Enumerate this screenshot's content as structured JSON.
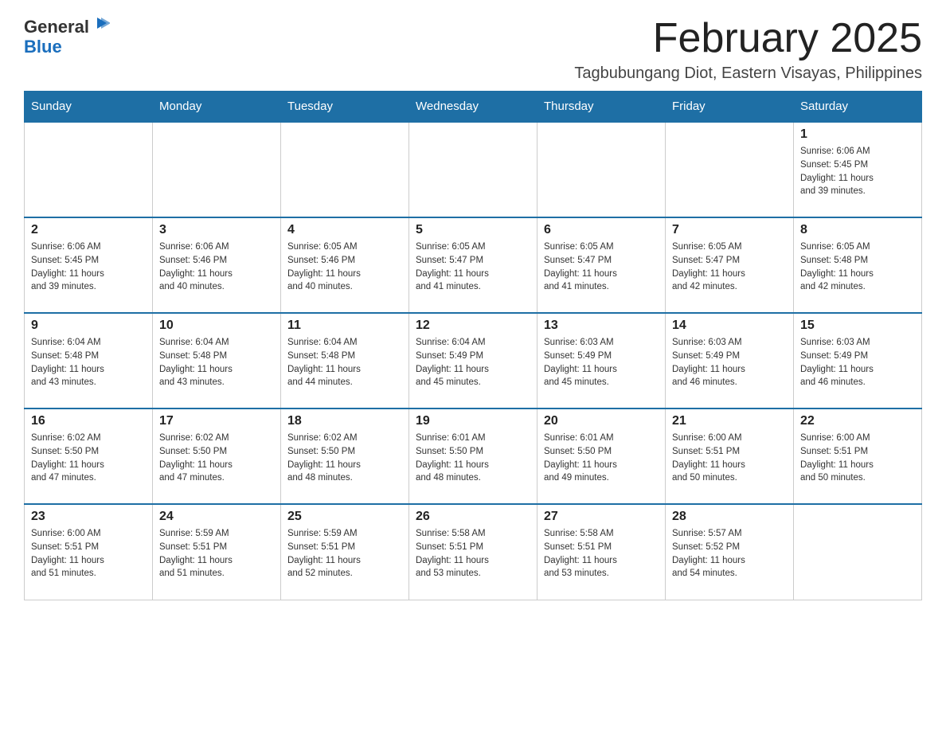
{
  "header": {
    "logo_general": "General",
    "logo_blue": "Blue",
    "title": "February 2025",
    "subtitle": "Tagbubungang Diot, Eastern Visayas, Philippines"
  },
  "days_of_week": [
    "Sunday",
    "Monday",
    "Tuesday",
    "Wednesday",
    "Thursday",
    "Friday",
    "Saturday"
  ],
  "weeks": [
    [
      {
        "day": "",
        "info": ""
      },
      {
        "day": "",
        "info": ""
      },
      {
        "day": "",
        "info": ""
      },
      {
        "day": "",
        "info": ""
      },
      {
        "day": "",
        "info": ""
      },
      {
        "day": "",
        "info": ""
      },
      {
        "day": "1",
        "info": "Sunrise: 6:06 AM\nSunset: 5:45 PM\nDaylight: 11 hours\nand 39 minutes."
      }
    ],
    [
      {
        "day": "2",
        "info": "Sunrise: 6:06 AM\nSunset: 5:45 PM\nDaylight: 11 hours\nand 39 minutes."
      },
      {
        "day": "3",
        "info": "Sunrise: 6:06 AM\nSunset: 5:46 PM\nDaylight: 11 hours\nand 40 minutes."
      },
      {
        "day": "4",
        "info": "Sunrise: 6:05 AM\nSunset: 5:46 PM\nDaylight: 11 hours\nand 40 minutes."
      },
      {
        "day": "5",
        "info": "Sunrise: 6:05 AM\nSunset: 5:47 PM\nDaylight: 11 hours\nand 41 minutes."
      },
      {
        "day": "6",
        "info": "Sunrise: 6:05 AM\nSunset: 5:47 PM\nDaylight: 11 hours\nand 41 minutes."
      },
      {
        "day": "7",
        "info": "Sunrise: 6:05 AM\nSunset: 5:47 PM\nDaylight: 11 hours\nand 42 minutes."
      },
      {
        "day": "8",
        "info": "Sunrise: 6:05 AM\nSunset: 5:48 PM\nDaylight: 11 hours\nand 42 minutes."
      }
    ],
    [
      {
        "day": "9",
        "info": "Sunrise: 6:04 AM\nSunset: 5:48 PM\nDaylight: 11 hours\nand 43 minutes."
      },
      {
        "day": "10",
        "info": "Sunrise: 6:04 AM\nSunset: 5:48 PM\nDaylight: 11 hours\nand 43 minutes."
      },
      {
        "day": "11",
        "info": "Sunrise: 6:04 AM\nSunset: 5:48 PM\nDaylight: 11 hours\nand 44 minutes."
      },
      {
        "day": "12",
        "info": "Sunrise: 6:04 AM\nSunset: 5:49 PM\nDaylight: 11 hours\nand 45 minutes."
      },
      {
        "day": "13",
        "info": "Sunrise: 6:03 AM\nSunset: 5:49 PM\nDaylight: 11 hours\nand 45 minutes."
      },
      {
        "day": "14",
        "info": "Sunrise: 6:03 AM\nSunset: 5:49 PM\nDaylight: 11 hours\nand 46 minutes."
      },
      {
        "day": "15",
        "info": "Sunrise: 6:03 AM\nSunset: 5:49 PM\nDaylight: 11 hours\nand 46 minutes."
      }
    ],
    [
      {
        "day": "16",
        "info": "Sunrise: 6:02 AM\nSunset: 5:50 PM\nDaylight: 11 hours\nand 47 minutes."
      },
      {
        "day": "17",
        "info": "Sunrise: 6:02 AM\nSunset: 5:50 PM\nDaylight: 11 hours\nand 47 minutes."
      },
      {
        "day": "18",
        "info": "Sunrise: 6:02 AM\nSunset: 5:50 PM\nDaylight: 11 hours\nand 48 minutes."
      },
      {
        "day": "19",
        "info": "Sunrise: 6:01 AM\nSunset: 5:50 PM\nDaylight: 11 hours\nand 48 minutes."
      },
      {
        "day": "20",
        "info": "Sunrise: 6:01 AM\nSunset: 5:50 PM\nDaylight: 11 hours\nand 49 minutes."
      },
      {
        "day": "21",
        "info": "Sunrise: 6:00 AM\nSunset: 5:51 PM\nDaylight: 11 hours\nand 50 minutes."
      },
      {
        "day": "22",
        "info": "Sunrise: 6:00 AM\nSunset: 5:51 PM\nDaylight: 11 hours\nand 50 minutes."
      }
    ],
    [
      {
        "day": "23",
        "info": "Sunrise: 6:00 AM\nSunset: 5:51 PM\nDaylight: 11 hours\nand 51 minutes."
      },
      {
        "day": "24",
        "info": "Sunrise: 5:59 AM\nSunset: 5:51 PM\nDaylight: 11 hours\nand 51 minutes."
      },
      {
        "day": "25",
        "info": "Sunrise: 5:59 AM\nSunset: 5:51 PM\nDaylight: 11 hours\nand 52 minutes."
      },
      {
        "day": "26",
        "info": "Sunrise: 5:58 AM\nSunset: 5:51 PM\nDaylight: 11 hours\nand 53 minutes."
      },
      {
        "day": "27",
        "info": "Sunrise: 5:58 AM\nSunset: 5:51 PM\nDaylight: 11 hours\nand 53 minutes."
      },
      {
        "day": "28",
        "info": "Sunrise: 5:57 AM\nSunset: 5:52 PM\nDaylight: 11 hours\nand 54 minutes."
      },
      {
        "day": "",
        "info": ""
      }
    ]
  ]
}
